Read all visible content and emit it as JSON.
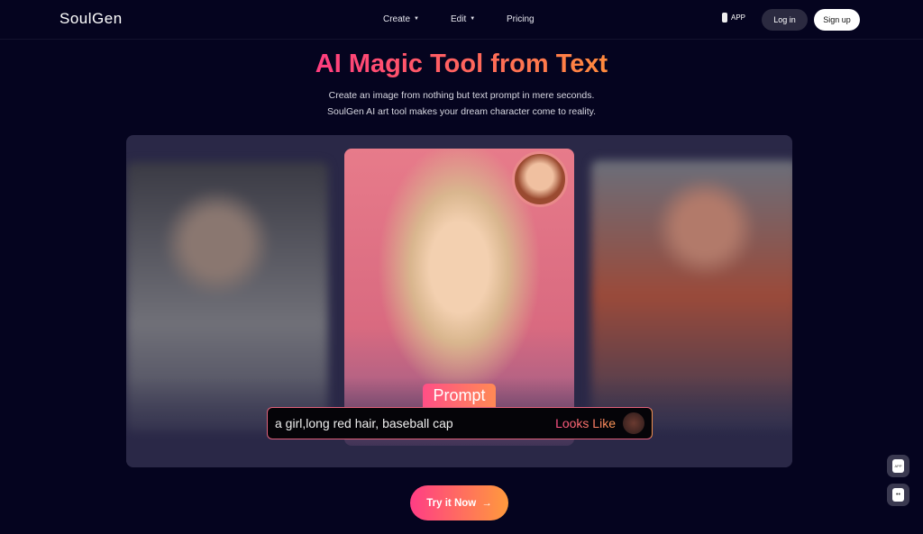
{
  "nav": {
    "logo": "SoulGen",
    "items": [
      {
        "label": "Create",
        "dropdown": true
      },
      {
        "label": "Edit",
        "dropdown": true
      },
      {
        "label": "Pricing"
      }
    ],
    "app": "APP",
    "login": "Log in",
    "signup": "Sign up"
  },
  "hero": {
    "title": "AI Magic Tool from Text",
    "subtitle_1": "Create an image from nothing but text prompt in mere seconds.",
    "subtitle_2": "SoulGen AI art tool makes your dream character come to reality."
  },
  "demo": {
    "prompt_tag": "Prompt",
    "prompt_text": "a girl,long red hair, baseball cap",
    "looks_like": "Looks Like"
  },
  "cta": {
    "label": "Try it Now",
    "arrow": "→"
  },
  "floating": {
    "app_label": "APP"
  },
  "colors": {
    "accent_start": "#ff3d85",
    "accent_end": "#ff9a3d",
    "background": "#05041f"
  }
}
